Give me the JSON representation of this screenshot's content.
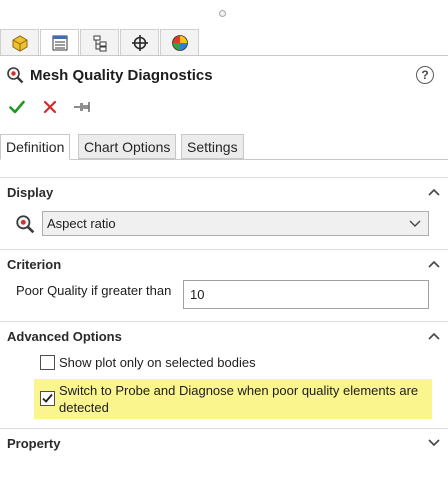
{
  "manager_tabs": [
    {
      "name": "feature-manager-tab",
      "icon": "part-icon"
    },
    {
      "name": "property-manager-tab",
      "icon": "property-list-icon"
    },
    {
      "name": "configuration-manager-tab",
      "icon": "configuration-tree-icon"
    },
    {
      "name": "dimxpert-manager-tab",
      "icon": "crosshair-icon"
    },
    {
      "name": "display-manager-tab",
      "icon": "color-wheel-icon"
    }
  ],
  "panel": {
    "title": "Mesh Quality Diagnostics",
    "help_symbol": "?"
  },
  "tabs": {
    "definition": "Definition",
    "chart_options": "Chart Options",
    "settings": "Settings"
  },
  "display": {
    "heading": "Display",
    "selected": "Aspect ratio"
  },
  "criterion": {
    "heading": "Criterion",
    "label": "Poor Quality if greater than",
    "value": "10"
  },
  "advanced": {
    "heading": "Advanced Options",
    "option1": {
      "label": "Show plot only on selected bodies",
      "checked": false
    },
    "option2": {
      "label": "Switch to Probe and Diagnose when poor quality elements are detected",
      "checked": true
    }
  },
  "property": {
    "heading": "Property"
  },
  "colors": {
    "ok_green": "#1e9b1e",
    "cancel_red": "#d42a2a",
    "highlight": "#faf58c"
  }
}
